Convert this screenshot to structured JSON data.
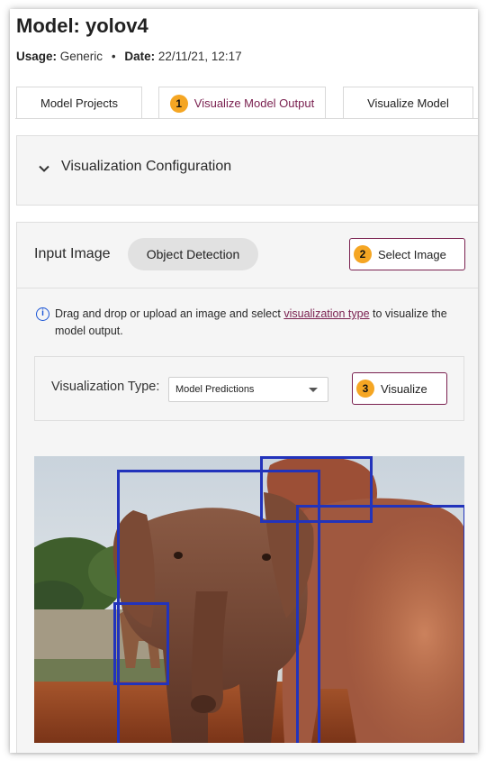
{
  "header": {
    "title": "Model: yolov4",
    "usage_label": "Usage:",
    "usage_value": "Generic",
    "separator": "•",
    "date_label": "Date:",
    "date_value": "22/11/21, 12:17"
  },
  "tabs": [
    {
      "label": "Model Projects",
      "badge": ""
    },
    {
      "label": "Visualize Model Output",
      "badge": "1",
      "active": true
    },
    {
      "label": "Visualize Model",
      "badge": ""
    }
  ],
  "config": {
    "title": "Visualization Configuration",
    "icon": "chevron-down-icon"
  },
  "input": {
    "title": "Input Image",
    "mode_chip": "Object Detection",
    "select_button": {
      "badge": "2",
      "label": "Select Image"
    }
  },
  "info": {
    "icon": "info-icon",
    "text_before": "Drag and drop or upload an image and select ",
    "link": "visualization type",
    "text_after": " to visualize the model output."
  },
  "visualization": {
    "label": "Visualization Type:",
    "selected": "Model Predictions",
    "button": {
      "badge": "3",
      "label": "Visualize"
    }
  },
  "image": {
    "description_icon": "elephant-photo",
    "box_color": "#2233bb",
    "box_count": 4
  },
  "colors": {
    "accent": "#7a2150",
    "badge": "#f5a623",
    "info": "#1a55d6"
  }
}
